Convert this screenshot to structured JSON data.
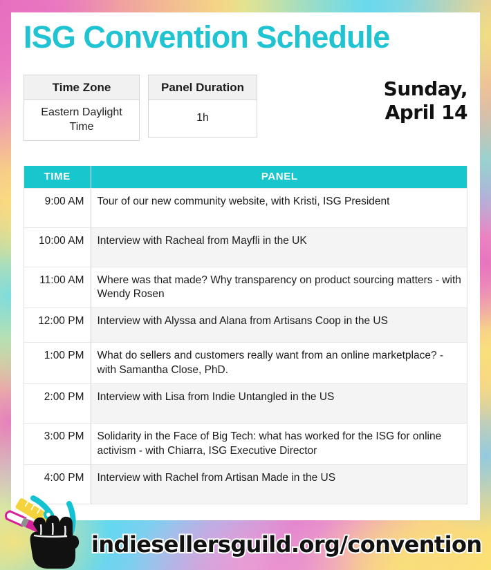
{
  "title": "ISG Convention Schedule",
  "meta": {
    "timezone_header": "Time Zone",
    "timezone_value": "Eastern Daylight Time",
    "duration_header": "Panel Duration",
    "duration_value": "1h"
  },
  "date": {
    "line1": "Sunday,",
    "line2": "April 14"
  },
  "schedule": {
    "columns": [
      "TIME",
      "PANEL"
    ],
    "rows": [
      {
        "time": "9:00 AM",
        "panel": "Tour of our new community website, with Kristi, ISG President"
      },
      {
        "time": "10:00 AM",
        "panel": "Interview with Racheal from Mayfli in the UK"
      },
      {
        "time": "11:00 AM",
        "panel": "Where was that made? Why transparency on product sourcing matters - with Wendy Rosen"
      },
      {
        "time": "12:00 PM",
        "panel": "Interview with Alyssa and Alana from Artisans Coop in the US"
      },
      {
        "time": "1:00 PM",
        "panel": "What do sellers and customers really want from an online marketplace? - with Samantha Close, PhD."
      },
      {
        "time": "2:00 PM",
        "panel": "Interview with Lisa from Indie Untangled in the US"
      },
      {
        "time": "3:00 PM",
        "panel": "Solidarity in the Face of Big Tech: what has worked for the ISG for online activism - with Chiarra, ISG Executive Director"
      },
      {
        "time": "4:00 PM",
        "panel": "Interview with Rachel from Artisan Made in the US"
      }
    ]
  },
  "footer": {
    "url": "indiesellersguild.org/convention",
    "logo_name": "isg-fist-tools-logo"
  },
  "colors": {
    "title_cyan": "#1fc3d2",
    "table_header_teal": "#18c6ce",
    "row_stripe": "#f4f4f4",
    "meta_header_gray": "#f1f1f1",
    "text_dark": "#1c1c1c",
    "time_gray": "#555555"
  }
}
